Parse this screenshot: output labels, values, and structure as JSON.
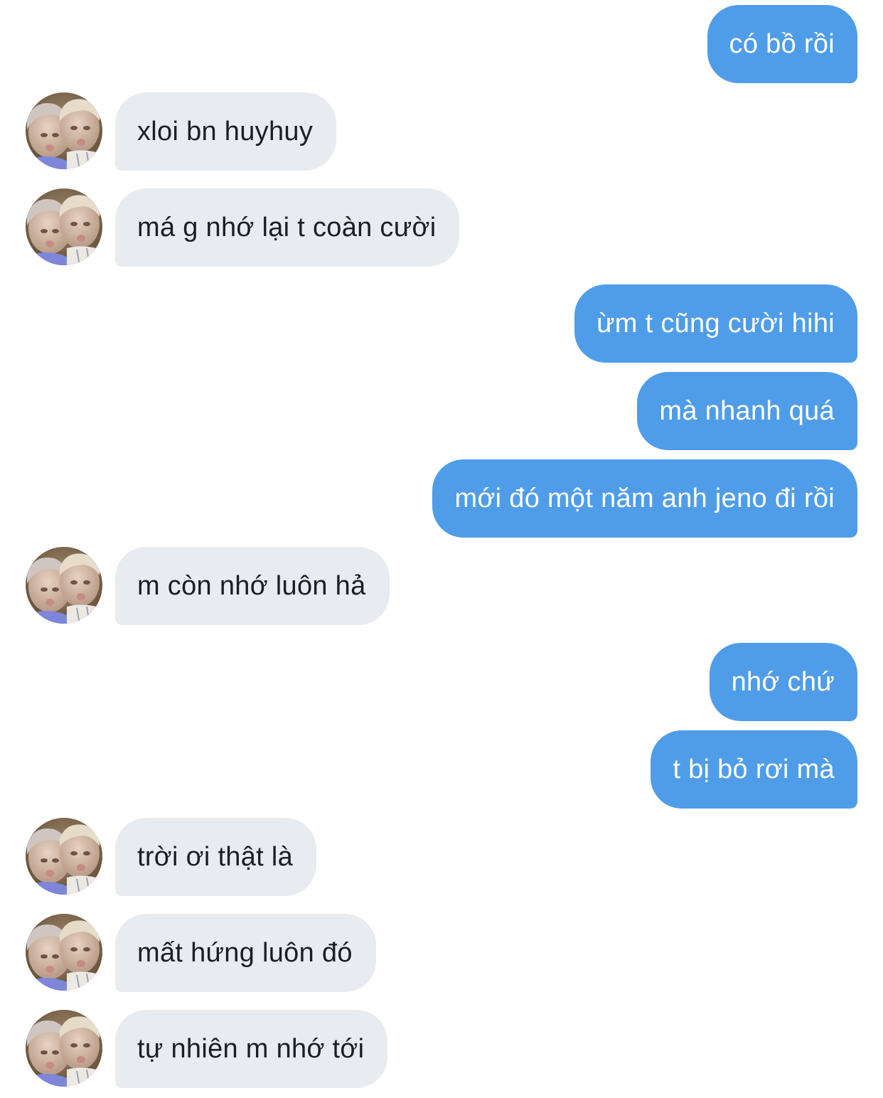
{
  "contact": {
    "avatar": "contact-avatar-photo"
  },
  "colors": {
    "outgoing_bubble": "#4f9de8",
    "incoming_bubble": "#e8ebef",
    "outgoing_text": "#ffffff",
    "incoming_text": "#1b1f23"
  },
  "messages": [
    {
      "direction": "outgoing",
      "text": "có bồ rồi"
    },
    {
      "direction": "incoming",
      "text": "xloi bn huyhuy"
    },
    {
      "direction": "incoming",
      "text": "má g nhớ lại t coàn cười"
    },
    {
      "direction": "outgoing",
      "text": "ừm t cũng cười hihi"
    },
    {
      "direction": "outgoing",
      "text": "mà nhanh quá"
    },
    {
      "direction": "outgoing",
      "text": "mới đó một năm anh jeno đi rồi"
    },
    {
      "direction": "incoming",
      "text": "m còn nhớ luôn hả"
    },
    {
      "direction": "outgoing",
      "text": "nhớ chứ"
    },
    {
      "direction": "outgoing",
      "text": "t bị bỏ rơi mà"
    },
    {
      "direction": "incoming",
      "text": "trời ơi thật là"
    },
    {
      "direction": "incoming",
      "text": "mất hứng luôn đó"
    },
    {
      "direction": "incoming",
      "text": "tự nhiên m nhớ tới"
    }
  ]
}
